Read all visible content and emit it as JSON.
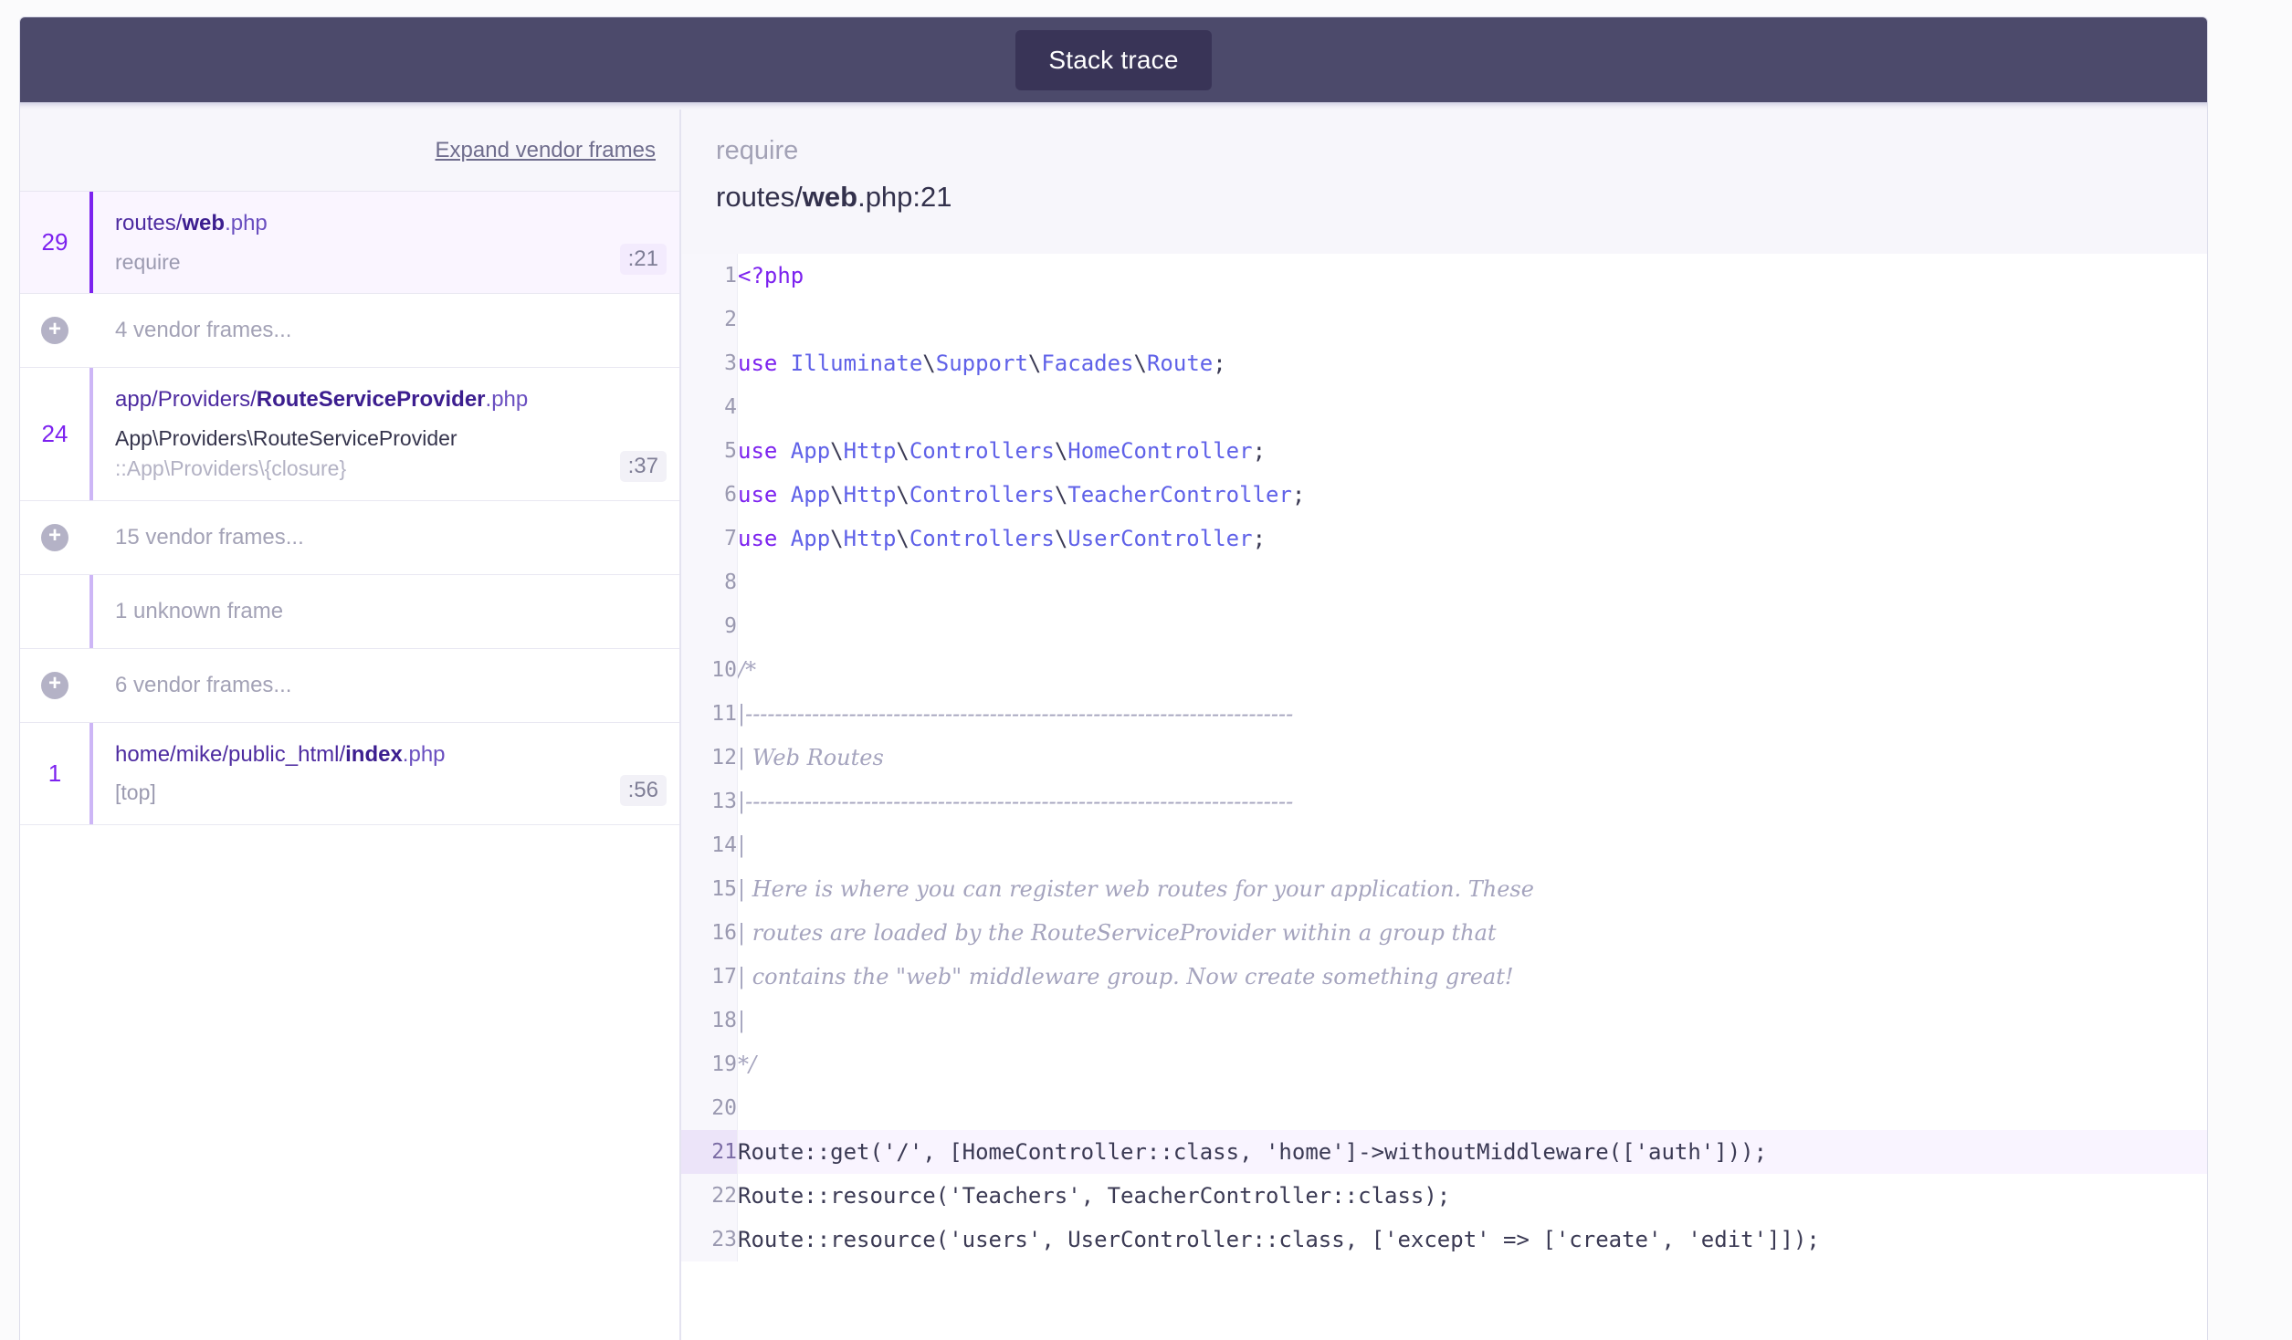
{
  "header": {
    "tab_label": "Stack trace"
  },
  "sidebar": {
    "expand_link": "Expand vendor frames",
    "frames": [
      {
        "num": "29",
        "file_prefix": "routes/",
        "file_bold": "web",
        "file_ext": ".php",
        "call": "require",
        "line": ":21",
        "type": "app",
        "active": true
      },
      {
        "num": "",
        "label": "4 vendor frames...",
        "type": "vendor",
        "icon": "plus-circle-icon"
      },
      {
        "num": "24",
        "file_prefix": "app/Providers/",
        "file_bold": "RouteServiceProvider",
        "file_ext": ".php",
        "call_strong": "App\\Providers\\RouteServiceProvider",
        "call_dim": "::App\\Providers\\{closure}",
        "line": ":37",
        "type": "app",
        "active": false
      },
      {
        "num": "",
        "label": "15 vendor frames...",
        "type": "vendor",
        "icon": "plus-circle-icon"
      },
      {
        "num": "",
        "label": "1 unknown frame",
        "type": "unknown"
      },
      {
        "num": "",
        "label": "6 vendor frames...",
        "type": "vendor",
        "icon": "plus-circle-icon"
      },
      {
        "num": "1",
        "file_prefix": "home/mike/public_html/",
        "file_bold": "index",
        "file_ext": ".php",
        "call": "[top]",
        "line": ":56",
        "type": "app",
        "active": false
      }
    ]
  },
  "code_panel": {
    "context": "require",
    "path_prefix": "routes/",
    "path_bold": "web",
    "path_suffix": ".php:21",
    "highlighted_line": 21,
    "lines": [
      {
        "n": 1,
        "tokens": [
          {
            "t": "<?php",
            "c": "kw"
          }
        ]
      },
      {
        "n": 2,
        "tokens": []
      },
      {
        "n": 3,
        "tokens": [
          {
            "t": "use ",
            "c": "kw"
          },
          {
            "t": "Illuminate",
            "c": "ns"
          },
          {
            "t": "\\",
            "c": "pun"
          },
          {
            "t": "Support",
            "c": "ns"
          },
          {
            "t": "\\",
            "c": "pun"
          },
          {
            "t": "Facades",
            "c": "ns"
          },
          {
            "t": "\\",
            "c": "pun"
          },
          {
            "t": "Route",
            "c": "ns"
          },
          {
            "t": ";",
            "c": "pun"
          }
        ]
      },
      {
        "n": 4,
        "tokens": []
      },
      {
        "n": 5,
        "tokens": [
          {
            "t": "use ",
            "c": "kw"
          },
          {
            "t": "App",
            "c": "ns"
          },
          {
            "t": "\\",
            "c": "pun"
          },
          {
            "t": "Http",
            "c": "ns"
          },
          {
            "t": "\\",
            "c": "pun"
          },
          {
            "t": "Controllers",
            "c": "ns"
          },
          {
            "t": "\\",
            "c": "pun"
          },
          {
            "t": "HomeController",
            "c": "ns"
          },
          {
            "t": ";",
            "c": "pun"
          }
        ]
      },
      {
        "n": 6,
        "tokens": [
          {
            "t": "use ",
            "c": "kw"
          },
          {
            "t": "App",
            "c": "ns"
          },
          {
            "t": "\\",
            "c": "pun"
          },
          {
            "t": "Http",
            "c": "ns"
          },
          {
            "t": "\\",
            "c": "pun"
          },
          {
            "t": "Controllers",
            "c": "ns"
          },
          {
            "t": "\\",
            "c": "pun"
          },
          {
            "t": "TeacherController",
            "c": "ns"
          },
          {
            "t": ";",
            "c": "pun"
          }
        ]
      },
      {
        "n": 7,
        "tokens": [
          {
            "t": "use ",
            "c": "kw"
          },
          {
            "t": "App",
            "c": "ns"
          },
          {
            "t": "\\",
            "c": "pun"
          },
          {
            "t": "Http",
            "c": "ns"
          },
          {
            "t": "\\",
            "c": "pun"
          },
          {
            "t": "Controllers",
            "c": "ns"
          },
          {
            "t": "\\",
            "c": "pun"
          },
          {
            "t": "UserController",
            "c": "ns"
          },
          {
            "t": ";",
            "c": "pun"
          }
        ]
      },
      {
        "n": 8,
        "tokens": []
      },
      {
        "n": 9,
        "tokens": []
      },
      {
        "n": 10,
        "tokens": [
          {
            "t": "/*",
            "c": "cm"
          }
        ]
      },
      {
        "n": 11,
        "tokens": [
          {
            "t": "|--------------------------------------------------------------------------",
            "c": "cm"
          }
        ]
      },
      {
        "n": 12,
        "tokens": [
          {
            "t": "| Web Routes",
            "c": "cm"
          }
        ]
      },
      {
        "n": 13,
        "tokens": [
          {
            "t": "|--------------------------------------------------------------------------",
            "c": "cm"
          }
        ]
      },
      {
        "n": 14,
        "tokens": [
          {
            "t": "|",
            "c": "cm"
          }
        ]
      },
      {
        "n": 15,
        "tokens": [
          {
            "t": "| Here is where you can register web routes for your application. These",
            "c": "cm"
          }
        ]
      },
      {
        "n": 16,
        "tokens": [
          {
            "t": "| routes are loaded by the RouteServiceProvider within a group that",
            "c": "cm"
          }
        ]
      },
      {
        "n": 17,
        "tokens": [
          {
            "t": "| contains the \"web\" middleware group. Now create something great!",
            "c": "cm"
          }
        ]
      },
      {
        "n": 18,
        "tokens": [
          {
            "t": "|",
            "c": "cm"
          }
        ]
      },
      {
        "n": 19,
        "tokens": [
          {
            "t": "*/",
            "c": "cm"
          }
        ]
      },
      {
        "n": 20,
        "tokens": []
      },
      {
        "n": 21,
        "tokens": [
          {
            "t": "Route::get('/', [HomeController::class, 'home']->withoutMiddleware(['auth']));",
            "c": "pun"
          }
        ]
      },
      {
        "n": 22,
        "tokens": [
          {
            "t": "Route::resource('Teachers', TeacherController::class);",
            "c": "pun"
          }
        ]
      },
      {
        "n": 23,
        "tokens": [
          {
            "t": "Route::resource('users', UserController::class, ['except' => ['create', 'edit']]);",
            "c": "pun"
          }
        ]
      }
    ]
  },
  "colors": {
    "header_bg": "#4c4a6b",
    "tab_bg": "#393457",
    "accent": "#7c22ef",
    "link": "#4d2ba0",
    "highlight_row": "#f9f4ff"
  }
}
